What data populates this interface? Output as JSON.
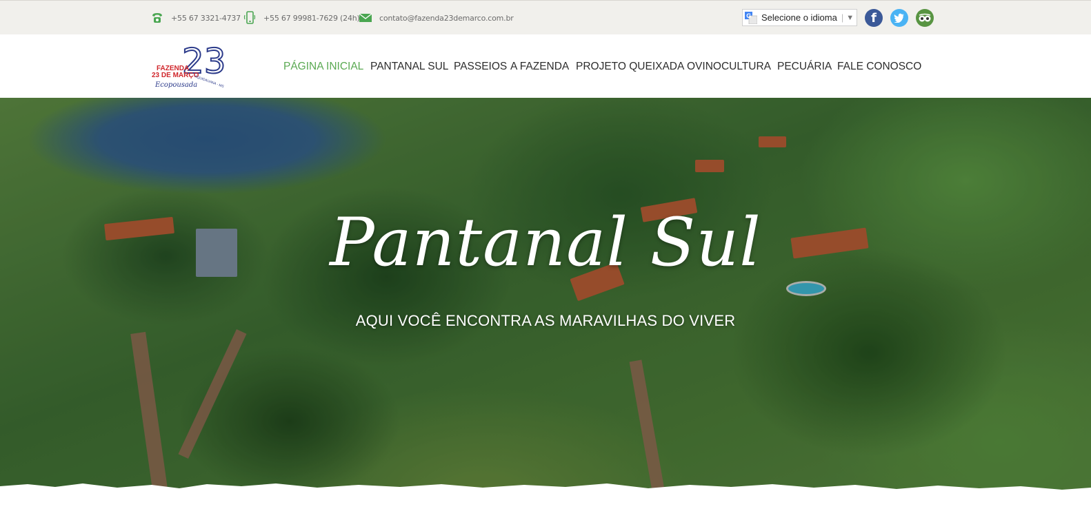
{
  "topbar": {
    "phone": "+55 67 3321-4737",
    "mobile": "+55 67 99981-7629 (24h)",
    "email": "contato@fazenda23demarco.com.br",
    "language_label": "Selecione o idioma",
    "language_separator": "|",
    "language_arrow": "▼",
    "icons": {
      "phone": "phone-icon",
      "mobile": "mobile-icon",
      "email": "email-icon",
      "facebook": "facebook-icon",
      "twitter": "twitter-icon",
      "tripadvisor": "tripadvisor-icon"
    }
  },
  "logo": {
    "line1": "FAZENDA",
    "line2": "23 DE MARÇO",
    "number": "23",
    "tagline": "Ecopousada",
    "location": "AQUIDAUANA - MS"
  },
  "nav": {
    "items": [
      "PÁGINA INICIAL",
      "PANTANAL SUL",
      "PASSEIOS",
      "A FAZENDA",
      "PROJETO QUEIXADA",
      "OVINOCULTURA",
      "PECUÁRIA",
      "FALE CONOSCO"
    ],
    "active_index": 0
  },
  "hero": {
    "title": "Pantanal Sul",
    "subtitle": "AQUI VOCÊ ENCONTRA AS MARAVILHAS DO VIVER"
  },
  "colors": {
    "accent_green": "#5aa952",
    "topbar_bg": "#f1f0ec",
    "nav_text": "#2c2c2c",
    "logo_red": "#d0262b",
    "logo_blue": "#2b3a8a"
  }
}
